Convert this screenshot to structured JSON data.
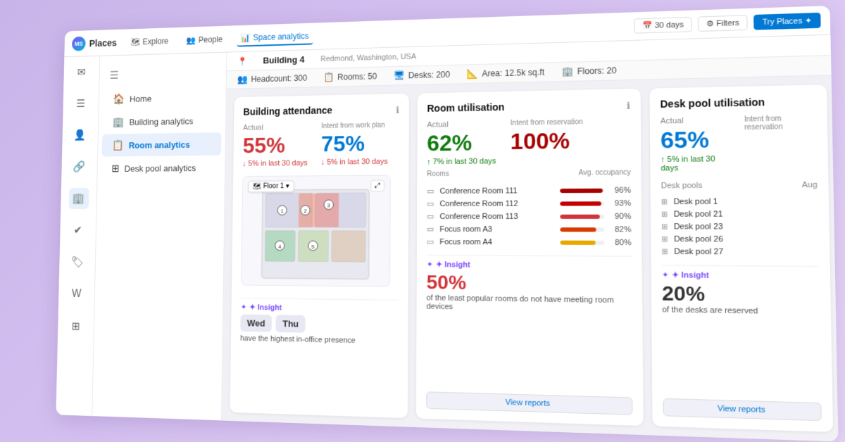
{
  "app": {
    "name": "Places",
    "logo_text": "MS"
  },
  "top_nav": {
    "items": [
      {
        "label": "Explore",
        "icon": "🗺",
        "active": false
      },
      {
        "label": "People",
        "icon": "👥",
        "active": false
      },
      {
        "label": "Space analytics",
        "icon": "📊",
        "active": true
      }
    ],
    "right_buttons": [
      {
        "label": "30 days",
        "icon": "📅"
      },
      {
        "label": "Filters",
        "icon": "⚙"
      },
      {
        "label": "Try Places ✦",
        "active": true
      }
    ]
  },
  "sidebar": {
    "icons": [
      "✉",
      "☰",
      "👤",
      "🔗",
      "🏢",
      "✔",
      "🏷",
      "W",
      "⊞"
    ]
  },
  "left_panel": {
    "items": [
      {
        "label": "Home",
        "icon": "🏠",
        "active": false
      },
      {
        "label": "Building analytics",
        "icon": "🏢",
        "active": false
      },
      {
        "label": "Room analytics",
        "icon": "📋",
        "active": true
      },
      {
        "label": "Desk pool analytics",
        "icon": "⊞",
        "active": false
      }
    ]
  },
  "building_bar": {
    "name": "Building 4",
    "location": "Redmond, Washington, USA",
    "stats": [
      {
        "label": "Headcount: 300",
        "icon": "👥"
      },
      {
        "label": "Rooms: 50",
        "icon": "📋"
      },
      {
        "label": "Desks: 200",
        "icon": "🖥"
      },
      {
        "label": "Area: 12.5k sq.ft",
        "icon": "📐"
      },
      {
        "label": "Floors: 20",
        "icon": "🏢"
      }
    ]
  },
  "building_attendance": {
    "title": "Building attendance",
    "actual_label": "Actual",
    "intent_label": "Intent from work plan",
    "actual_value": "55%",
    "intent_value": "75%",
    "actual_trend": "↓ 5% in last 30 days",
    "intent_trend": "↓ 5% in last 30 days",
    "floor_selector": "Floor 1",
    "insight_label": "✦ Insight",
    "insight_days": [
      "Wed",
      "Thu"
    ],
    "insight_text": "have the highest in-office presence"
  },
  "room_utilisation": {
    "title": "Room utilisation",
    "actual_label": "Actual",
    "intent_label": "Intent from reservation",
    "actual_value": "62%",
    "intent_value": "100%",
    "actual_trend": "↑ 7% in last 30 days",
    "intent_trend": "",
    "rooms_header": "Rooms",
    "occupancy_header": "Avg. occupancy",
    "rooms": [
      {
        "name": "Conference Room 111",
        "pct": 96,
        "color": "#a80000"
      },
      {
        "name": "Conference Room 112",
        "pct": 93,
        "color": "#c50000"
      },
      {
        "name": "Conference Room 113",
        "pct": 90,
        "color": "#d13438"
      },
      {
        "name": "Focus room A3",
        "pct": 82,
        "color": "#d83b01"
      },
      {
        "name": "Focus room A4",
        "pct": 80,
        "color": "#e8a800"
      }
    ],
    "insight_label": "✦ Insight",
    "insight_value": "50%",
    "insight_text": "of the least popular rooms do not have meeting room devices",
    "view_reports": "View reports"
  },
  "desk_pool": {
    "title": "Desk pool utilisation",
    "actual_label": "Actual",
    "intent_label": "Intent from reservation",
    "actual_value": "65%",
    "actual_trend": "↑ 5% in last 30 days",
    "desk_pools_label": "Desk pools",
    "aug_label": "Aug",
    "pools": [
      {
        "name": "Desk pool 1"
      },
      {
        "name": "Desk pool 21"
      },
      {
        "name": "Desk pool 23"
      },
      {
        "name": "Desk pool 26"
      },
      {
        "name": "Desk pool 27"
      }
    ],
    "insight_label": "✦ Insight",
    "insight_value": "20%",
    "insight_text": "of the desks are reserved",
    "view_reports": "View reports"
  },
  "colors": {
    "red": "#d13438",
    "green": "#107c10",
    "blue": "#0078d4",
    "orange": "#d83b01",
    "dark_red": "#a80000",
    "yellow": "#e8a800",
    "accent": "#0078d4"
  }
}
